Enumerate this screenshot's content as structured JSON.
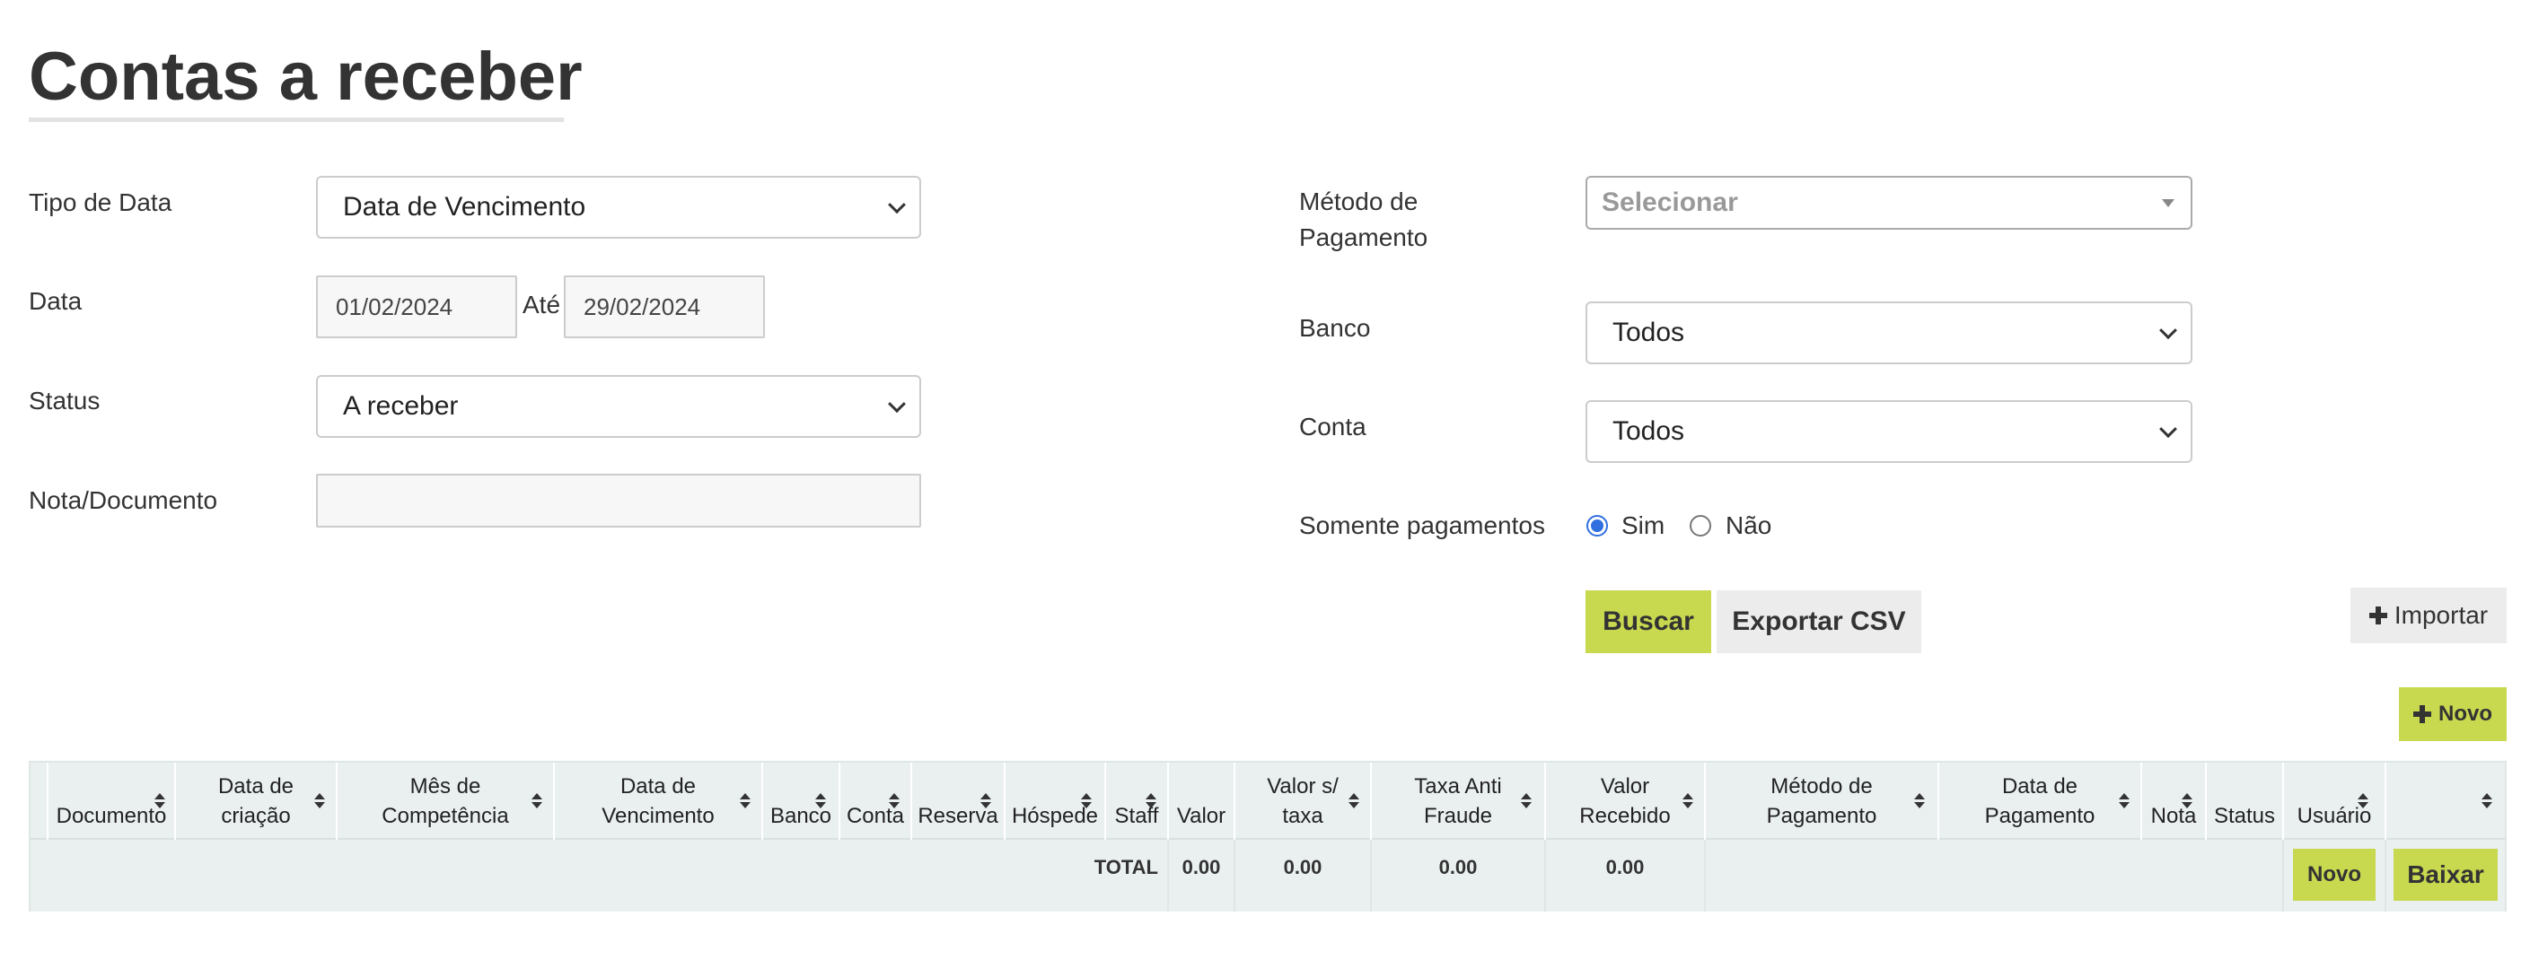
{
  "page": {
    "title": "Contas a receber"
  },
  "filters": {
    "tipo_data": {
      "label": "Tipo de Data",
      "value": "Data de Vencimento"
    },
    "data": {
      "label": "Data",
      "from": "01/02/2024",
      "to_label": "Até",
      "to": "29/02/2024"
    },
    "status": {
      "label": "Status",
      "value": "A receber"
    },
    "nota": {
      "label": "Nota/Documento",
      "value": ""
    },
    "metodo": {
      "label_line1": "Método de",
      "label_line2": "Pagamento",
      "placeholder": "Selecionar"
    },
    "banco": {
      "label": "Banco",
      "value": "Todos"
    },
    "conta": {
      "label": "Conta",
      "value": "Todos"
    },
    "somente": {
      "label": "Somente pagamentos",
      "option_yes": "Sim",
      "option_no": "Não",
      "selected": "Sim"
    }
  },
  "actions": {
    "buscar": "Buscar",
    "exportar": "Exportar CSV",
    "importar": "Importar",
    "novo": "Novo"
  },
  "table": {
    "headers": [
      {
        "line1": "",
        "line2": "Documento"
      },
      {
        "line1": "Data de",
        "line2": "criação"
      },
      {
        "line1": "Mês de",
        "line2": "Competência"
      },
      {
        "line1": "Data de",
        "line2": "Vencimento"
      },
      {
        "line1": "",
        "line2": "Banco"
      },
      {
        "line1": "",
        "line2": "Conta"
      },
      {
        "line1": "",
        "line2": "Reserva"
      },
      {
        "line1": "",
        "line2": "Hóspede"
      },
      {
        "line1": "",
        "line2": "Staff"
      },
      {
        "line1": "",
        "line2": "Valor"
      },
      {
        "line1": "Valor s/",
        "line2": "taxa"
      },
      {
        "line1": "Taxa Anti",
        "line2": "Fraude"
      },
      {
        "line1": "Valor",
        "line2": "Recebido"
      },
      {
        "line1": "Método de",
        "line2": "Pagamento"
      },
      {
        "line1": "Data de",
        "line2": "Pagamento"
      },
      {
        "line1": "",
        "line2": "Nota"
      },
      {
        "line1": "",
        "line2": "Status"
      },
      {
        "line1": "",
        "line2": "Usuário"
      },
      {
        "line1": "",
        "line2": ""
      }
    ],
    "total_row": {
      "label": "TOTAL",
      "valor": "0.00",
      "valor_sem_taxa": "0.00",
      "taxa_anti_fraude": "0.00",
      "valor_recebido": "0.00",
      "novo_button": "Novo",
      "baixar_button": "Baixar"
    }
  },
  "colors": {
    "accent": "#c8d84f",
    "table_bg": "#eaf0f0",
    "radio": "#2f6fe0"
  }
}
